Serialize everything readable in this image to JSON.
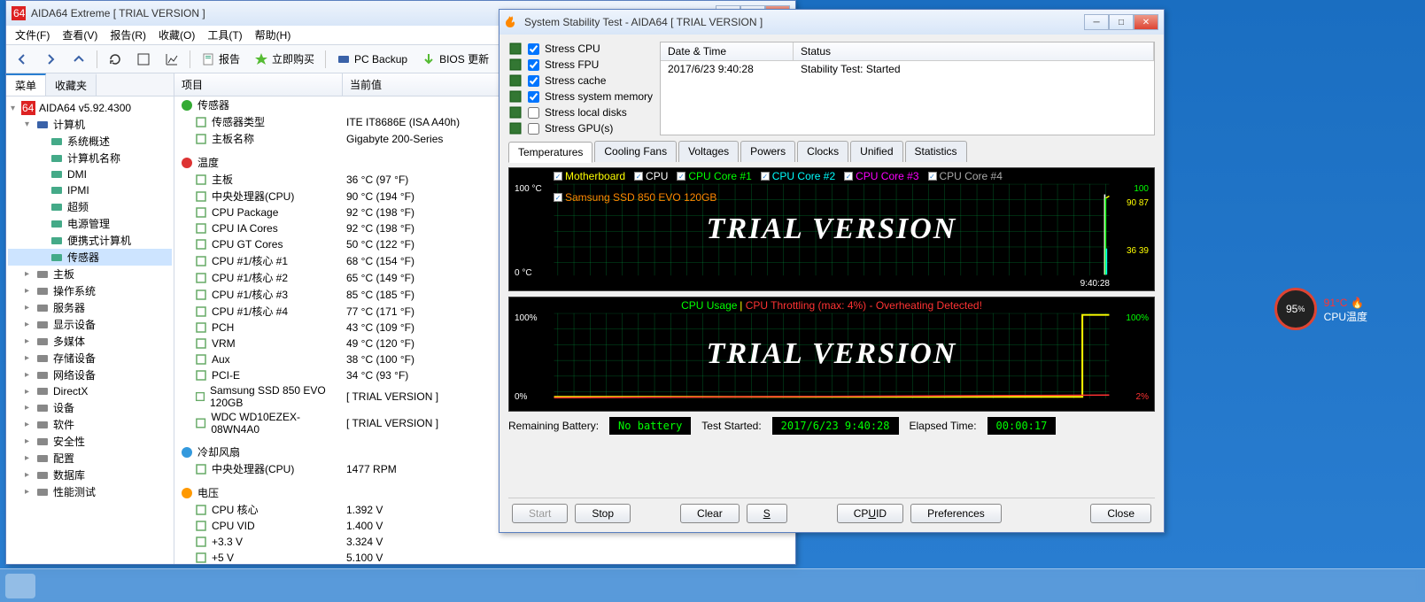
{
  "main_window": {
    "title": "AIDA64 Extreme   [ TRIAL VERSION ]",
    "menus": [
      "文件(F)",
      "查看(V)",
      "报告(R)",
      "收藏(O)",
      "工具(T)",
      "帮助(H)"
    ],
    "toolbar": {
      "report": "报告",
      "buy_now": "立即购买",
      "pc_backup": "PC Backup",
      "bios_update": "BIOS 更新"
    },
    "side_tabs": {
      "menu": "菜单",
      "fav": "收藏夹"
    },
    "tree_root": "AIDA64 v5.92.4300",
    "tree": [
      {
        "label": "计算机",
        "expanded": true,
        "children": [
          "系统概述",
          "计算机名称",
          "DMI",
          "IPMI",
          "超频",
          "电源管理",
          "便携式计算机",
          "传感器"
        ]
      },
      {
        "label": "主板"
      },
      {
        "label": "操作系统"
      },
      {
        "label": "服务器"
      },
      {
        "label": "显示设备"
      },
      {
        "label": "多媒体"
      },
      {
        "label": "存储设备"
      },
      {
        "label": "网络设备"
      },
      {
        "label": "DirectX"
      },
      {
        "label": "设备"
      },
      {
        "label": "软件"
      },
      {
        "label": "安全性"
      },
      {
        "label": "配置"
      },
      {
        "label": "数据库"
      },
      {
        "label": "性能测试"
      }
    ],
    "selected_tree": "传感器",
    "list_headers": {
      "item": "项目",
      "value": "当前值"
    },
    "groups": [
      {
        "name": "传感器",
        "rows": [
          {
            "item": "传感器类型",
            "value": "ITE IT8686E  (ISA A40h)"
          },
          {
            "item": "主板名称",
            "value": "Gigabyte 200-Series"
          }
        ]
      },
      {
        "name": "温度",
        "rows": [
          {
            "item": "主板",
            "value": "36 °C  (97 °F)"
          },
          {
            "item": "中央处理器(CPU)",
            "value": "90 °C  (194 °F)"
          },
          {
            "item": "CPU Package",
            "value": "92 °C  (198 °F)"
          },
          {
            "item": "CPU IA Cores",
            "value": "92 °C  (198 °F)"
          },
          {
            "item": "CPU GT Cores",
            "value": "50 °C  (122 °F)"
          },
          {
            "item": "CPU #1/核心 #1",
            "value": "68 °C  (154 °F)"
          },
          {
            "item": "CPU #1/核心 #2",
            "value": "65 °C  (149 °F)"
          },
          {
            "item": "CPU #1/核心 #3",
            "value": "85 °C  (185 °F)"
          },
          {
            "item": "CPU #1/核心 #4",
            "value": "77 °C  (171 °F)"
          },
          {
            "item": "PCH",
            "value": "43 °C  (109 °F)"
          },
          {
            "item": "VRM",
            "value": "49 °C  (120 °F)"
          },
          {
            "item": "Aux",
            "value": "38 °C  (100 °F)"
          },
          {
            "item": "PCI-E",
            "value": "34 °C  (93 °F)"
          },
          {
            "item": "Samsung SSD 850 EVO 120GB",
            "value": "[ TRIAL VERSION ]"
          },
          {
            "item": "WDC WD10EZEX-08WN4A0",
            "value": "[ TRIAL VERSION ]"
          }
        ]
      },
      {
        "name": "冷却风扇",
        "rows": [
          {
            "item": "中央处理器(CPU)",
            "value": "1477 RPM"
          }
        ]
      },
      {
        "name": "电压",
        "rows": [
          {
            "item": "CPU 核心",
            "value": "1.392 V"
          },
          {
            "item": "CPU VID",
            "value": "1.400 V"
          },
          {
            "item": "+3.3 V",
            "value": "3.324 V"
          },
          {
            "item": "+5 V",
            "value": "5.100 V"
          }
        ]
      }
    ]
  },
  "stability_window": {
    "title": "System Stability Test - AIDA64   [ TRIAL VERSION ]",
    "stress_options": [
      {
        "label": "Stress CPU",
        "checked": true
      },
      {
        "label": "Stress FPU",
        "checked": true
      },
      {
        "label": "Stress cache",
        "checked": true
      },
      {
        "label": "Stress system memory",
        "checked": true
      },
      {
        "label": "Stress local disks",
        "checked": false
      },
      {
        "label": "Stress GPU(s)",
        "checked": false
      }
    ],
    "log_headers": {
      "dt": "Date & Time",
      "status": "Status"
    },
    "log_rows": [
      {
        "dt": "2017/6/23 9:40:28",
        "status": "Stability Test: Started"
      }
    ],
    "graph_tabs": [
      "Temperatures",
      "Cooling Fans",
      "Voltages",
      "Powers",
      "Clocks",
      "Unified",
      "Statistics"
    ],
    "active_tab": "Temperatures",
    "temp_graph": {
      "watermark": "TRIAL VERSION",
      "y_top": "100 °C",
      "y_bot": "0 °C",
      "x_right": "9:40:28",
      "r_vals": [
        "100",
        "90 87",
        "36 39"
      ],
      "legend": [
        {
          "name": "Motherboard",
          "color": "#ff0"
        },
        {
          "name": "CPU",
          "color": "#fff"
        },
        {
          "name": "CPU Core #1",
          "color": "#0f0"
        },
        {
          "name": "CPU Core #2",
          "color": "#0ff"
        },
        {
          "name": "CPU Core #3",
          "color": "#f0f"
        },
        {
          "name": "CPU Core #4",
          "color": "#aaa"
        },
        {
          "name": "Samsung SSD 850 EVO 120GB",
          "color": "#f80"
        }
      ]
    },
    "usage_graph": {
      "title_left": "CPU Usage",
      "title_right": "CPU Throttling (max: 4%) - Overheating Detected!",
      "watermark": "TRIAL VERSION",
      "y_top": "100%",
      "y_bot": "0%",
      "r_vals": [
        "100%",
        "2%"
      ]
    },
    "status": {
      "remaining_battery_label": "Remaining Battery:",
      "remaining_battery_value": "No battery",
      "test_started_label": "Test Started:",
      "test_started_value": "2017/6/23 9:40:28",
      "elapsed_label": "Elapsed Time:",
      "elapsed_value": "00:00:17"
    },
    "buttons": {
      "start": "Start",
      "stop": "Stop",
      "clear": "Clear",
      "save": "Save",
      "cpuid": "CPUID",
      "prefs": "Preferences",
      "close": "Close"
    }
  },
  "widget": {
    "pct": "95",
    "pct_unit": "%",
    "temp": "91°C",
    "label": "CPU温度"
  },
  "chart_data": [
    {
      "type": "line",
      "title": "Temperatures",
      "ylim": [
        0,
        100
      ],
      "ylabel": "°C",
      "x_right": "9:40:28",
      "series": [
        {
          "name": "Motherboard",
          "last": 36
        },
        {
          "name": "CPU",
          "last": 90
        },
        {
          "name": "CPU Core #1",
          "last": 87
        },
        {
          "name": "CPU Core #2",
          "last": 87
        },
        {
          "name": "CPU Core #3",
          "last": 90
        },
        {
          "name": "CPU Core #4",
          "last": 87
        },
        {
          "name": "Samsung SSD 850 EVO 120GB",
          "last": 39
        }
      ],
      "right_labels": [
        100,
        90,
        87,
        36,
        39
      ]
    },
    {
      "type": "line",
      "title": "CPU Usage / Throttling",
      "ylim": [
        0,
        100
      ],
      "ylabel": "%",
      "series": [
        {
          "name": "CPU Usage",
          "last": 100,
          "color": "yellow"
        },
        {
          "name": "CPU Throttling",
          "last": 2,
          "max": 4,
          "color": "red"
        }
      ],
      "annotation": "Overheating Detected!"
    }
  ]
}
